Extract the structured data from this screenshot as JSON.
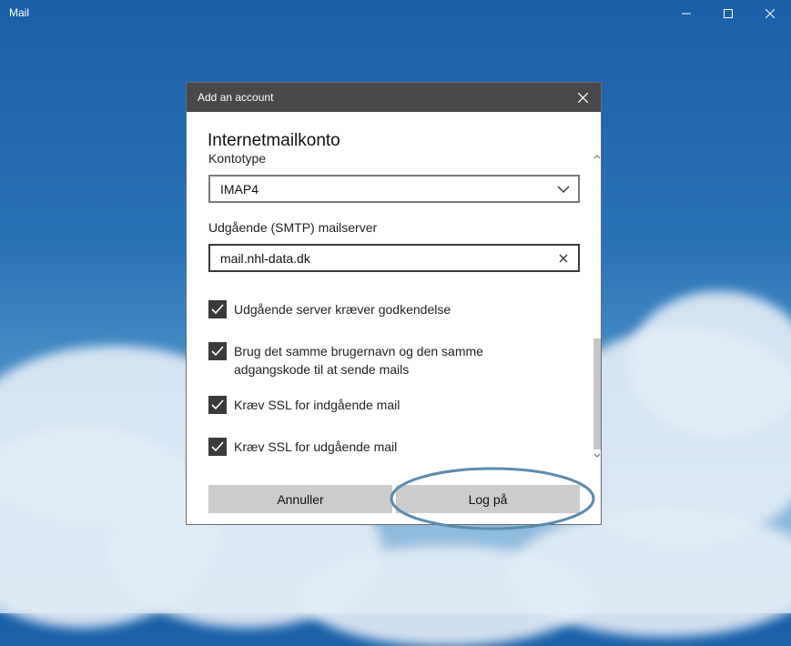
{
  "app": {
    "title": "Mail"
  },
  "window_controls": {
    "minimize_icon": "minimize-icon",
    "maximize_icon": "maximize-icon",
    "close_icon": "close-icon"
  },
  "dialog": {
    "title": "Add an account",
    "heading": "Internetmailkonto",
    "account_type": {
      "label": "Kontotype",
      "value": "IMAP4"
    },
    "smtp_server": {
      "label": "Udgående (SMTP) mailserver",
      "value": "mail.nhl-data.dk"
    },
    "checkboxes": [
      {
        "label": "Udgående server kræver godkendelse",
        "checked": true
      },
      {
        "label_line1": "Brug det samme brugernavn og den samme",
        "label_line2": "adgangskode til at sende mails",
        "checked": true
      },
      {
        "label": "Kræv SSL for indgående mail",
        "checked": true
      },
      {
        "label": "Kræv SSL for udgående mail",
        "checked": true
      }
    ],
    "cancel_label": "Annuller",
    "signin_label": "Log på"
  },
  "colors": {
    "highlight_ring": "#5a8bb0",
    "dialog_header": "#4a4846"
  }
}
